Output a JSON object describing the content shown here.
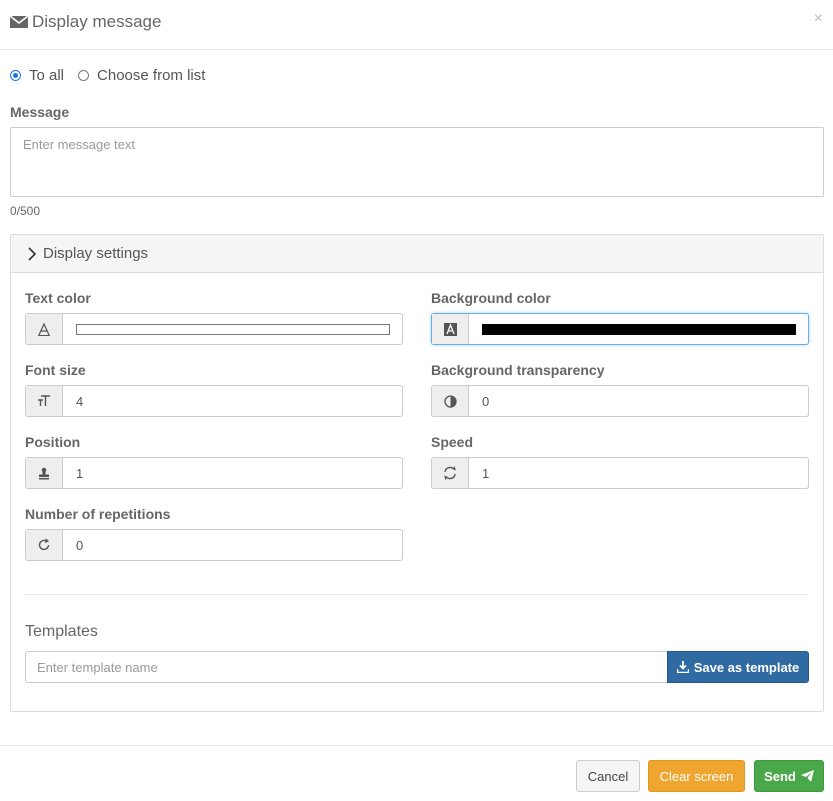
{
  "header": {
    "title": "Display message",
    "close": "×"
  },
  "recipients": {
    "option_all": "To all",
    "option_list": "Choose from list",
    "selected": "To all"
  },
  "message": {
    "label": "Message",
    "placeholder": "Enter message text",
    "counter": "0/500"
  },
  "settings": {
    "title": "Display settings",
    "text_color": {
      "label": "Text color",
      "value": "#ffffff",
      "icon": "font-icon"
    },
    "background_color": {
      "label": "Background color",
      "value": "#000000",
      "icon": "font-filled-icon"
    },
    "font_size": {
      "label": "Font size",
      "value": "4",
      "icon": "text-size-icon"
    },
    "background_transparency": {
      "label": "Background transparency",
      "value": "0",
      "icon": "half-circle-icon"
    },
    "position": {
      "label": "Position",
      "value": "1",
      "icon": "stamp-icon"
    },
    "speed": {
      "label": "Speed",
      "value": "1",
      "icon": "refresh-icon"
    },
    "repetitions": {
      "label": "Number of repetitions",
      "value": "0",
      "icon": "repeat-icon"
    }
  },
  "templates": {
    "title": "Templates",
    "placeholder": "Enter template name",
    "save_label": "Save as template"
  },
  "footer": {
    "cancel": "Cancel",
    "clear": "Clear screen",
    "send": "Send"
  },
  "colors": {
    "accent": "#2f6aa3",
    "warning": "#f0a530",
    "success": "#4aa84a"
  }
}
